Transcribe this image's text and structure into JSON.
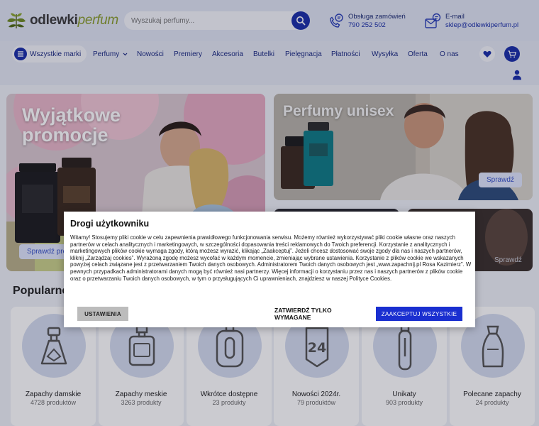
{
  "header": {
    "logo_main": "odlewki",
    "logo_accent": "perfum",
    "search_placeholder": "Wyszukaj perfumy...",
    "orders_label": "Obsługa zamówień",
    "orders_phone": "790 252 502",
    "email_label": "E-mail",
    "email_value": "sklep@odlewkiperfum.pl"
  },
  "nav": {
    "brands_label": "Wszystkie marki",
    "items": [
      "Perfumy",
      "Nowości",
      "Premiery",
      "Akcesoria",
      "Butelki",
      "Pielęgnacja",
      "Płatności",
      "Wysyłka",
      "Oferta",
      "O nas"
    ]
  },
  "banners": {
    "promo_title_line1": "Wyjątkowe",
    "promo_title_line2": "promocje",
    "promo_button": "Sprawdź pro",
    "unisex_title": "Perfumy unisex",
    "unisex_button": "Sprawdź",
    "small_right_button": "Sprawdź"
  },
  "section": {
    "popular_title": "Popularne"
  },
  "categories": [
    {
      "name": "Zapachy damskie",
      "count": "4728 produktów",
      "icon": "perfume-bottle-icon"
    },
    {
      "name": "Zapachy meskie",
      "count": "3263 produkty",
      "icon": "square-bottle-icon"
    },
    {
      "name": "Wkrótce dostępne",
      "count": "23 produkty",
      "icon": "round-bottle-icon"
    },
    {
      "name": "Nowości 2024r.",
      "count": "79 produktów",
      "icon": "24-badge-icon"
    },
    {
      "name": "Unikaty",
      "count": "903 produkty",
      "icon": "vial-icon"
    },
    {
      "name": "Polecane zapachy",
      "count": "24 produkty",
      "icon": "atomizer-icon"
    }
  ],
  "cookie": {
    "title": "Drogi użytkowniku",
    "body": "Witamy! Stosujemy pliki cookie w celu zapewnienia prawidłowego funkcjonowania serwisu. Możemy również wykorzystywać pliki cookie własne oraz naszych partnerów w celach analitycznych i marketingowych, w szczególności dopasowania treści reklamowych do Twoich preferencji. Korzystanie z analitycznych i marketingowych plików cookie wymaga zgody, którą możesz wyrazić, klikając „Zaakceptuj”. Jeżeli chcesz dostosować swoje zgody dla nas i naszych partnerów, kliknij „Zarządzaj cookies”. Wyrażoną zgodę możesz wycofać w każdym momencie, zmieniając wybrane ustawienia. Korzystanie z plików cookie we wskazanych powyżej celach związane jest z przetwarzaniem Twoich danych osobowych. Administratorem Twoich danych osobowych jest „www.zapachnij.pl Rosa Kazimierz”. W pewnych przypadkach administratorami danych mogą być również nasi partnerzy. Więcej informacji o korzystaniu przez nas i naszych partnerów z plików cookie oraz o przetwarzaniu Twoich danych osobowych, w tym o przysługujących Ci uprawnieniach, znajdziesz w naszej Polityce Cookies.",
    "settings_button": "USTAWIENIA",
    "required_button": "ZATWIERDŹ TYLKO WYMAGANE",
    "accept_button": "ZAAKCEPTUJ WSZYSTKIE"
  },
  "colors": {
    "brand_blue": "#1a2fa8",
    "accept_blue": "#1a2fd0",
    "logo_green": "#8a9d2d",
    "nav_text": "#1c2b82"
  }
}
